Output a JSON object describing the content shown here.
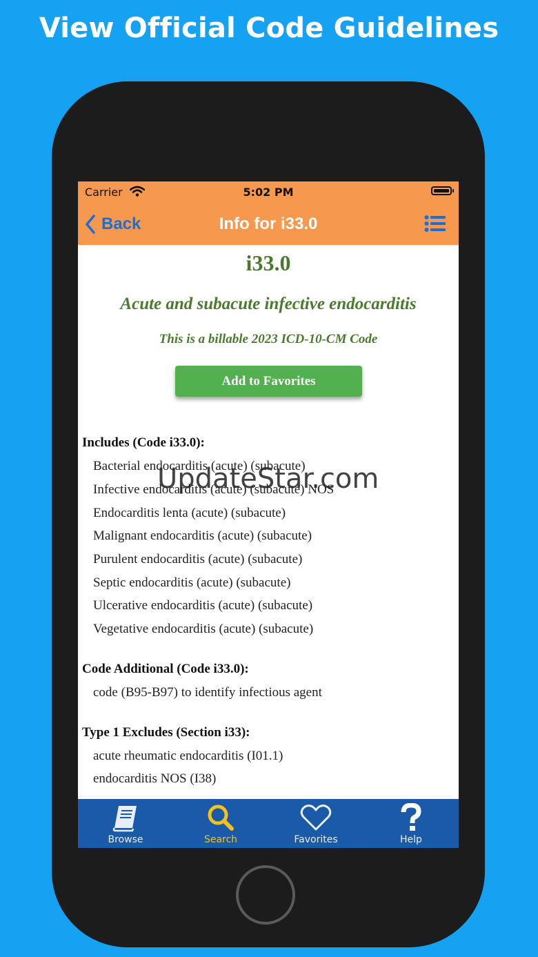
{
  "headline": "View Official Code Guidelines",
  "status_bar": {
    "carrier": "Carrier",
    "time": "5:02 PM"
  },
  "nav": {
    "back_label": "Back",
    "title": "Info for i33.0"
  },
  "code": {
    "id": "i33.0",
    "description": "Acute and subacute infective endocarditis",
    "billable_note": "This is a billable 2023 ICD-10-CM Code"
  },
  "add_favorites_label": "Add to Favorites",
  "watermark": "UpdateStar.com",
  "sections": {
    "includes": {
      "heading": "Includes (Code i33.0):",
      "items": [
        "Bacterial endocarditis (acute) (subacute)",
        "Infective endocarditis (acute) (subacute) NOS",
        "Endocarditis lenta (acute) (subacute)",
        "Malignant endocarditis (acute) (subacute)",
        "Purulent endocarditis (acute) (subacute)",
        "Septic endocarditis (acute) (subacute)",
        "Ulcerative endocarditis (acute) (subacute)",
        "Vegetative endocarditis (acute) (subacute)"
      ]
    },
    "code_additional": {
      "heading": "Code Additional (Code i33.0):",
      "items": [
        "code (B95-B97) to identify infectious agent"
      ]
    },
    "type1_excludes": {
      "heading": "Type 1 Excludes (Section i33):",
      "items": [
        "acute rheumatic endocarditis (I01.1)",
        "endocarditis NOS (I38)"
      ]
    }
  },
  "tabs": [
    {
      "label": "Browse",
      "icon": "book-icon"
    },
    {
      "label": "Search",
      "icon": "search-icon",
      "active": true
    },
    {
      "label": "Favorites",
      "icon": "heart-icon"
    },
    {
      "label": "Help",
      "icon": "question-icon"
    }
  ],
  "colors": {
    "background": "#16a2f3",
    "navbar": "#f6984d",
    "accent_green": "#4a7a2c",
    "button_green": "#53b04f",
    "tabbar": "#1a5aa8",
    "tab_active": "#f4c21a",
    "back_blue": "#1a6fd6"
  }
}
